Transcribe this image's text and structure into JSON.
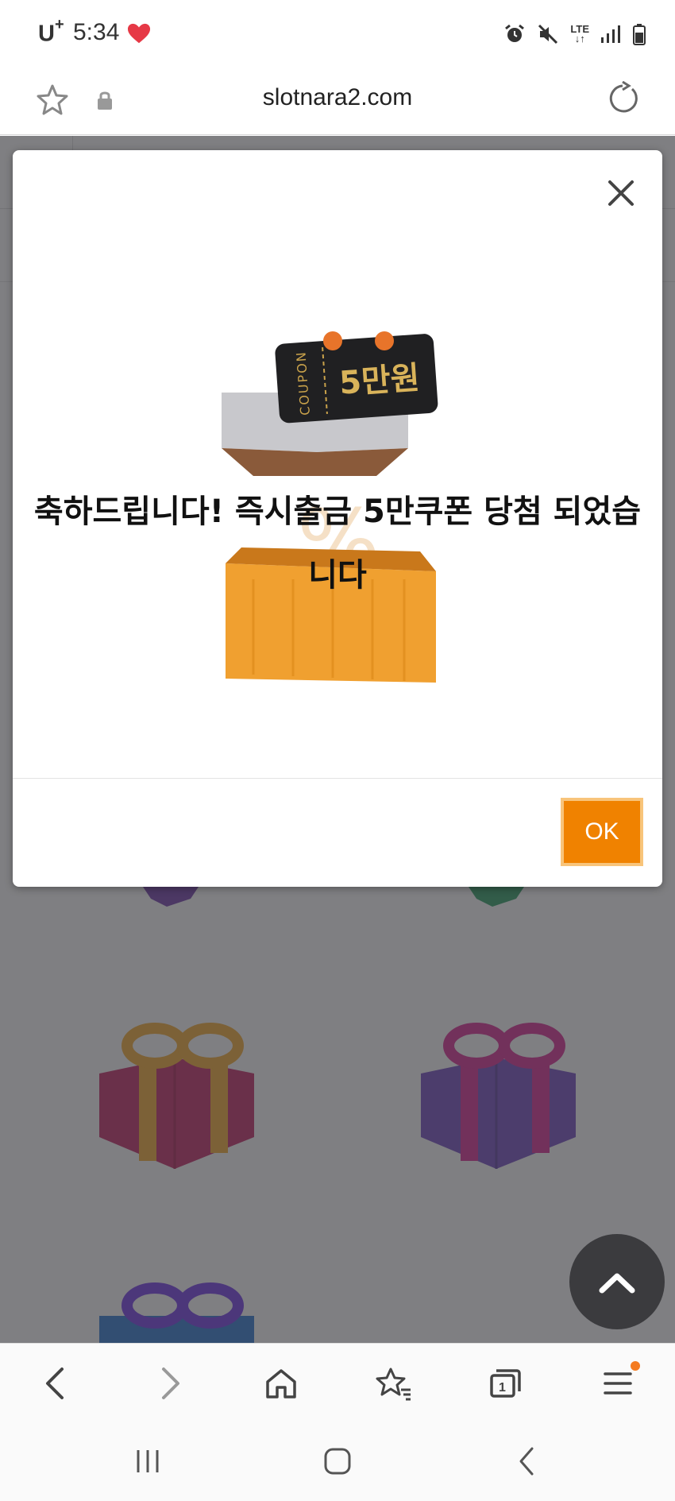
{
  "status_bar": {
    "carrier": "U",
    "carrier_mark": "+",
    "time": "5:34",
    "network": "LTE",
    "icons": [
      "heart-icon",
      "alarm-icon",
      "mute-icon",
      "lte-icon",
      "signal-icon",
      "battery-icon"
    ]
  },
  "browser": {
    "url": "slotnara2.com",
    "icons": [
      "bookmark-star-icon",
      "lock-icon",
      "reload-icon"
    ]
  },
  "modal": {
    "message": "축하드립니다! 즉시출금 5만쿠폰 당첨 되었습니다",
    "coupon_label": "COUPON",
    "coupon_value": "5만원",
    "ok_label": "OK"
  },
  "toolbar": {
    "tab_count": "1",
    "icons": [
      "back-icon",
      "forward-icon",
      "home-icon",
      "bookmarks-icon",
      "tabs-icon",
      "menu-icon"
    ]
  },
  "system_nav": {
    "icons": [
      "recents-icon",
      "home-circle-icon",
      "system-back-icon"
    ]
  },
  "colors": {
    "accent": "#f08200",
    "overlay": "#3c3c42",
    "heart": "#e63946"
  }
}
